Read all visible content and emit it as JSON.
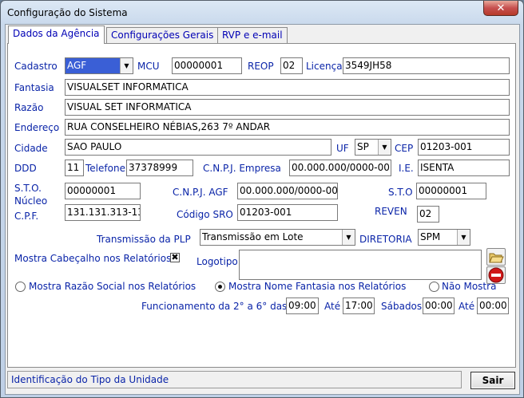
{
  "window": {
    "title": "Configuração do Sistema",
    "close_symbol": "✕"
  },
  "tabs": [
    "Dados da Agência",
    "Configurações Gerais",
    "RVP e e-mail"
  ],
  "labels": {
    "cadastro": "Cadastro",
    "mcu": "MCU",
    "reop": "REOP",
    "licenca": "Licença",
    "fantasia": "Fantasia",
    "razao": "Razão",
    "endereco": "Endereço",
    "cidade": "Cidade",
    "uf": "UF",
    "cep": "CEP",
    "ddd": "DDD",
    "telefone": "Telefone",
    "cnpj_empresa": "C.N.P.J. Empresa",
    "ie": "I.E.",
    "sto": "S.T.O.",
    "nucleo": "Núcleo",
    "cnpj_agf": "C.N.P.J. AGF",
    "sto2": "S.T.O",
    "cpf": "C.P.F.",
    "codigo_sro": "Código SRO",
    "reven": "REVEN",
    "transmissao": "Transmissão da PLP",
    "diretoria": "DIRETORIA",
    "mostra_cabecalho": "Mostra Cabeçalho nos Relatórios",
    "logotipo": "Logotipo",
    "radio_razao": "Mostra Razão Social nos Relatórios",
    "radio_fantasia": "Mostra Nome Fantasia nos Relatórios",
    "radio_nao": "Não Mostra",
    "funcionamento": "Funcionamento da 2° a 6° das",
    "ate": "Até",
    "sabados": "Sábados",
    "ate2": "Até"
  },
  "values": {
    "cadastro": "AGF",
    "mcu": "00000001",
    "reop": "02",
    "licenca": "3549JH58",
    "fantasia": "VISUALSET INFORMATICA",
    "razao": "VISUAL SET INFORMATICA",
    "endereco": "RUA CONSELHEIRO NÉBIAS,263 7º ANDAR",
    "cidade": "SAO PAULO",
    "uf": "SP",
    "cep": "01203-001",
    "ddd": "11",
    "telefone": "37378999",
    "cnpj_empresa": "00.000.000/0000-00",
    "ie": "ISENTA",
    "sto_nucleo": "00000001",
    "cnpj_agf": "00.000.000/0000-00",
    "sto2": "00000001",
    "cpf": "131.131.313-13",
    "codigo_sro": "01203-001",
    "reven": "02",
    "transmissao": "Transmissão em Lote",
    "diretoria": "SPM",
    "mostra_cabecalho_checked": "✖",
    "hora_inicio": "09:00",
    "hora_fim": "17:00",
    "sabado_inicio": "00:00",
    "sabado_fim": "00:00"
  },
  "radio_selected": "fantasia",
  "status": {
    "text": "Identificação do Tipo da Unidade"
  },
  "buttons": {
    "sair": "Sair"
  },
  "icons": {
    "open_folder": "folder-open-icon",
    "no_entry": "no-entry-icon",
    "dropdown": "▼"
  }
}
